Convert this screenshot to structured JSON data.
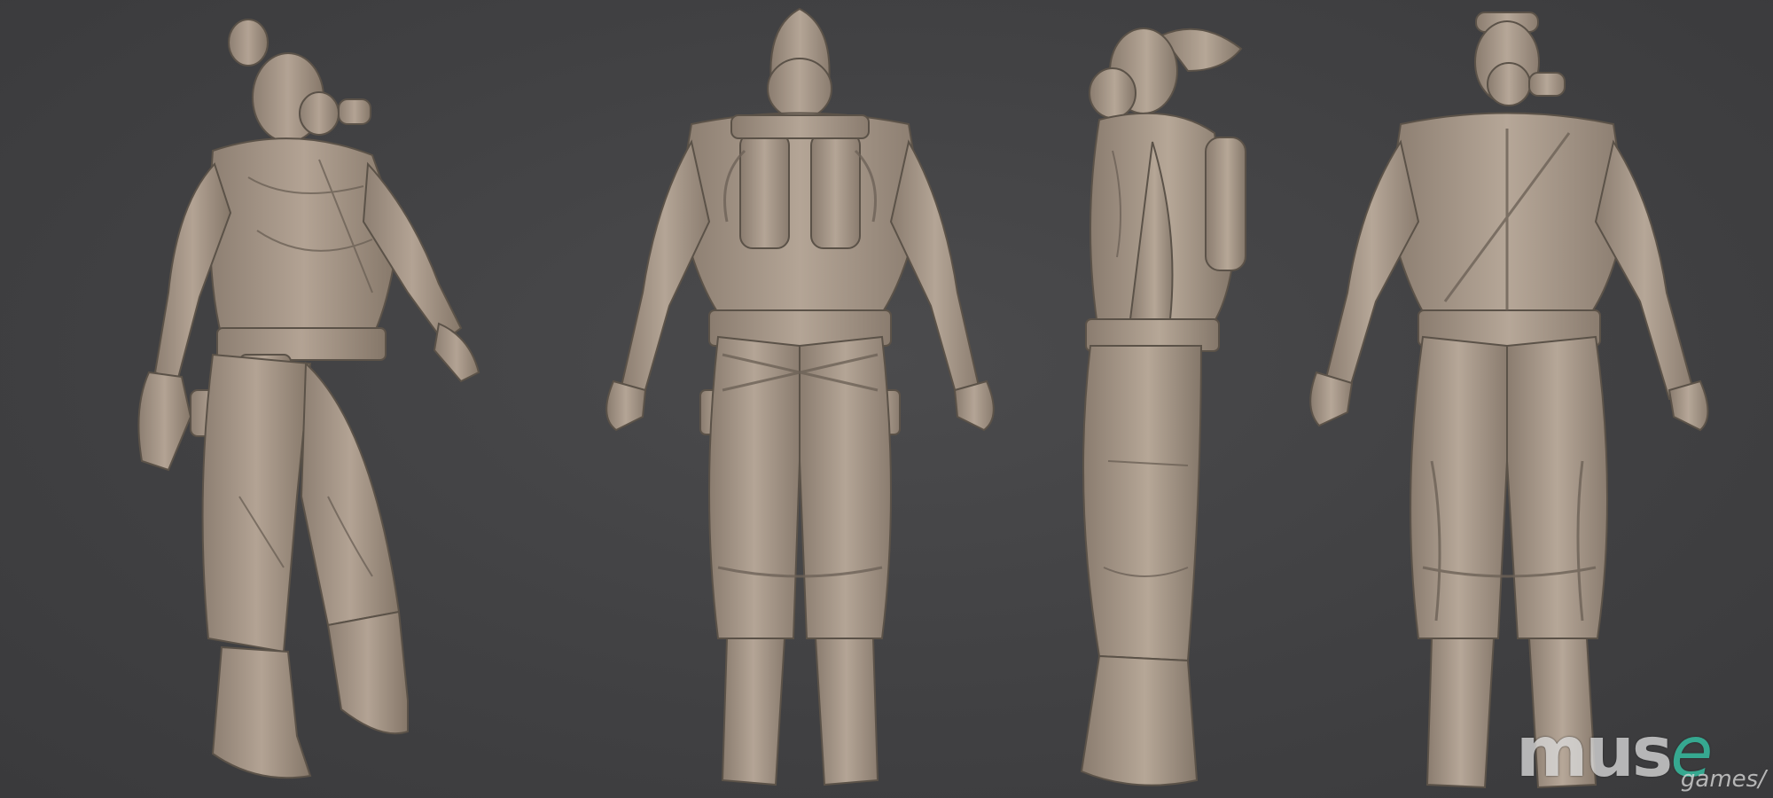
{
  "scene": {
    "background_color": "#434345",
    "model_color": "#a9998a",
    "views": [
      {
        "name": "perspective",
        "label": ""
      },
      {
        "name": "back",
        "label": ""
      },
      {
        "name": "side",
        "label": ""
      },
      {
        "name": "front",
        "label": ""
      }
    ]
  },
  "logo": {
    "word_main": "mus",
    "word_accent": "e",
    "sub": "games/",
    "accent_color": "#35c7a8"
  }
}
